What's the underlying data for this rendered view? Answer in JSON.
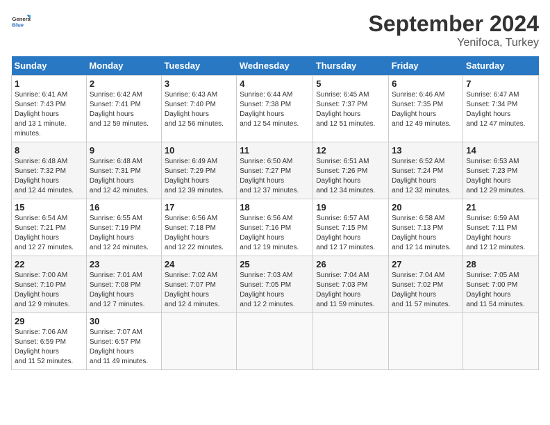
{
  "header": {
    "logo_general": "General",
    "logo_blue": "Blue",
    "month_title": "September 2024",
    "location": "Yenifoca, Turkey"
  },
  "days_of_week": [
    "Sunday",
    "Monday",
    "Tuesday",
    "Wednesday",
    "Thursday",
    "Friday",
    "Saturday"
  ],
  "weeks": [
    [
      {
        "num": "1",
        "sunrise": "6:41 AM",
        "sunset": "7:43 PM",
        "daylight": "13 hours and 1 minute."
      },
      {
        "num": "2",
        "sunrise": "6:42 AM",
        "sunset": "7:41 PM",
        "daylight": "12 hours and 59 minutes."
      },
      {
        "num": "3",
        "sunrise": "6:43 AM",
        "sunset": "7:40 PM",
        "daylight": "12 hours and 56 minutes."
      },
      {
        "num": "4",
        "sunrise": "6:44 AM",
        "sunset": "7:38 PM",
        "daylight": "12 hours and 54 minutes."
      },
      {
        "num": "5",
        "sunrise": "6:45 AM",
        "sunset": "7:37 PM",
        "daylight": "12 hours and 51 minutes."
      },
      {
        "num": "6",
        "sunrise": "6:46 AM",
        "sunset": "7:35 PM",
        "daylight": "12 hours and 49 minutes."
      },
      {
        "num": "7",
        "sunrise": "6:47 AM",
        "sunset": "7:34 PM",
        "daylight": "12 hours and 47 minutes."
      }
    ],
    [
      {
        "num": "8",
        "sunrise": "6:48 AM",
        "sunset": "7:32 PM",
        "daylight": "12 hours and 44 minutes."
      },
      {
        "num": "9",
        "sunrise": "6:48 AM",
        "sunset": "7:31 PM",
        "daylight": "12 hours and 42 minutes."
      },
      {
        "num": "10",
        "sunrise": "6:49 AM",
        "sunset": "7:29 PM",
        "daylight": "12 hours and 39 minutes."
      },
      {
        "num": "11",
        "sunrise": "6:50 AM",
        "sunset": "7:27 PM",
        "daylight": "12 hours and 37 minutes."
      },
      {
        "num": "12",
        "sunrise": "6:51 AM",
        "sunset": "7:26 PM",
        "daylight": "12 hours and 34 minutes."
      },
      {
        "num": "13",
        "sunrise": "6:52 AM",
        "sunset": "7:24 PM",
        "daylight": "12 hours and 32 minutes."
      },
      {
        "num": "14",
        "sunrise": "6:53 AM",
        "sunset": "7:23 PM",
        "daylight": "12 hours and 29 minutes."
      }
    ],
    [
      {
        "num": "15",
        "sunrise": "6:54 AM",
        "sunset": "7:21 PM",
        "daylight": "12 hours and 27 minutes."
      },
      {
        "num": "16",
        "sunrise": "6:55 AM",
        "sunset": "7:19 PM",
        "daylight": "12 hours and 24 minutes."
      },
      {
        "num": "17",
        "sunrise": "6:56 AM",
        "sunset": "7:18 PM",
        "daylight": "12 hours and 22 minutes."
      },
      {
        "num": "18",
        "sunrise": "6:56 AM",
        "sunset": "7:16 PM",
        "daylight": "12 hours and 19 minutes."
      },
      {
        "num": "19",
        "sunrise": "6:57 AM",
        "sunset": "7:15 PM",
        "daylight": "12 hours and 17 minutes."
      },
      {
        "num": "20",
        "sunrise": "6:58 AM",
        "sunset": "7:13 PM",
        "daylight": "12 hours and 14 minutes."
      },
      {
        "num": "21",
        "sunrise": "6:59 AM",
        "sunset": "7:11 PM",
        "daylight": "12 hours and 12 minutes."
      }
    ],
    [
      {
        "num": "22",
        "sunrise": "7:00 AM",
        "sunset": "7:10 PM",
        "daylight": "12 hours and 9 minutes."
      },
      {
        "num": "23",
        "sunrise": "7:01 AM",
        "sunset": "7:08 PM",
        "daylight": "12 hours and 7 minutes."
      },
      {
        "num": "24",
        "sunrise": "7:02 AM",
        "sunset": "7:07 PM",
        "daylight": "12 hours and 4 minutes."
      },
      {
        "num": "25",
        "sunrise": "7:03 AM",
        "sunset": "7:05 PM",
        "daylight": "12 hours and 2 minutes."
      },
      {
        "num": "26",
        "sunrise": "7:04 AM",
        "sunset": "7:03 PM",
        "daylight": "11 hours and 59 minutes."
      },
      {
        "num": "27",
        "sunrise": "7:04 AM",
        "sunset": "7:02 PM",
        "daylight": "11 hours and 57 minutes."
      },
      {
        "num": "28",
        "sunrise": "7:05 AM",
        "sunset": "7:00 PM",
        "daylight": "11 hours and 54 minutes."
      }
    ],
    [
      {
        "num": "29",
        "sunrise": "7:06 AM",
        "sunset": "6:59 PM",
        "daylight": "11 hours and 52 minutes."
      },
      {
        "num": "30",
        "sunrise": "7:07 AM",
        "sunset": "6:57 PM",
        "daylight": "11 hours and 49 minutes."
      },
      null,
      null,
      null,
      null,
      null
    ]
  ]
}
